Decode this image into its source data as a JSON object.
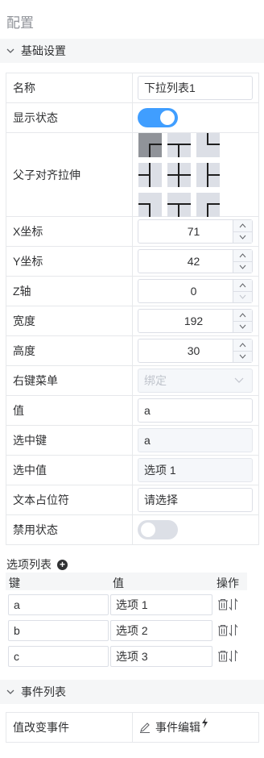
{
  "title": "配置",
  "basic": {
    "header": "基础设置",
    "name_label": "名称",
    "name_value": "下拉列表1",
    "visible_label": "显示状态",
    "visible_on": true,
    "align_label": "父子对齐拉伸",
    "x_label": "X坐标",
    "x_value": "71",
    "y_label": "Y坐标",
    "y_value": "42",
    "z_label": "Z轴",
    "z_value": "0",
    "width_label": "宽度",
    "width_value": "192",
    "height_label": "高度",
    "height_value": "30",
    "menu_label": "右键菜单",
    "menu_placeholder": "绑定",
    "value_label": "值",
    "value_value": "a",
    "selkey_label": "选中键",
    "selkey_value": "a",
    "selval_label": "选中值",
    "selval_value": "选项 1",
    "placeholder_label": "文本占位符",
    "placeholder_value": "请选择",
    "disabled_label": "禁用状态",
    "disabled_on": false
  },
  "options": {
    "title": "选项列表",
    "col_key": "键",
    "col_value": "值",
    "col_action": "操作",
    "rows": [
      {
        "key": "a",
        "value": "选项 1"
      },
      {
        "key": "b",
        "value": "选项 2"
      },
      {
        "key": "c",
        "value": "选项 3"
      }
    ]
  },
  "events": {
    "header": "事件列表",
    "change_label": "值改变事件",
    "edit_label": "事件编辑"
  },
  "colors": {
    "accent": "#409eff",
    "border": "#e6e8eb",
    "header_bg": "#f5f6f7"
  },
  "icons": [
    "chevron-down-icon",
    "plus-circle-icon",
    "trash-icon",
    "sort-icon",
    "edit-icon",
    "lightning-icon",
    "caret-up-icon",
    "caret-down-icon"
  ]
}
